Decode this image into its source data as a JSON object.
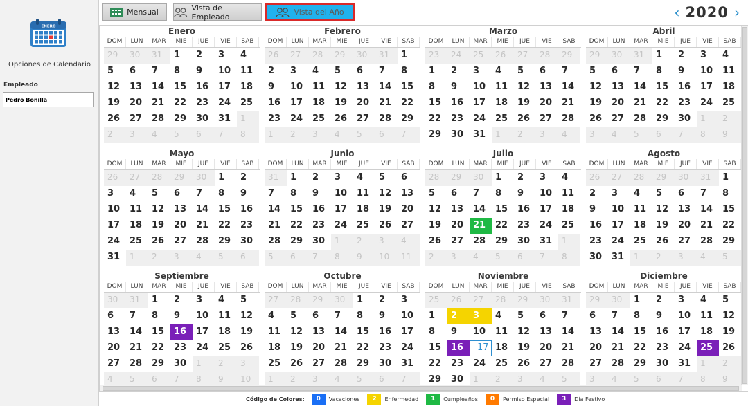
{
  "sidebar": {
    "logo_month": "ENERO",
    "title": "Opciones de Calendario",
    "employee_label": "Empleado",
    "employee_value": "Pedro Bonilla"
  },
  "toolbar": {
    "mensual_label": "Mensual",
    "empleado_label": "Vista de Empleado",
    "anio_label": "Vista del Año"
  },
  "year_nav": {
    "prev_icon": "‹",
    "next_icon": "›",
    "year": "2020"
  },
  "weekdays": [
    "DOM",
    "LUN",
    "MAR",
    "MIE",
    "JUE",
    "VIE",
    "SAB"
  ],
  "months": [
    {
      "name": "Enero",
      "lead": [
        29,
        30,
        31
      ],
      "days": 31,
      "trail": [
        1,
        2,
        3,
        4,
        5,
        6,
        7,
        8
      ]
    },
    {
      "name": "Febrero",
      "lead": [
        26,
        27,
        28,
        29,
        30,
        31
      ],
      "days": 29,
      "trail": [
        1,
        2,
        3,
        4,
        5,
        6,
        7
      ]
    },
    {
      "name": "Marzo",
      "lead": [
        23,
        24,
        25,
        26,
        27,
        28,
        29
      ],
      "days": 31,
      "trail": [
        1,
        2,
        3,
        4
      ]
    },
    {
      "name": "Abril",
      "lead": [
        29,
        30,
        31
      ],
      "days": 30,
      "trail": [
        1,
        2,
        3,
        4,
        5,
        6,
        7,
        8,
        9
      ]
    },
    {
      "name": "Mayo",
      "lead": [
        26,
        27,
        28,
        29,
        30
      ],
      "days": 31,
      "trail": [
        1,
        2,
        3,
        4,
        5,
        6
      ]
    },
    {
      "name": "Junio",
      "lead": [
        31
      ],
      "days": 30,
      "trail": [
        1,
        2,
        3,
        4,
        5,
        6,
        7,
        8,
        9,
        10,
        11
      ]
    },
    {
      "name": "Julio",
      "lead": [
        28,
        29,
        30
      ],
      "days": 31,
      "trail": [
        1,
        2,
        3,
        4,
        5,
        6,
        7,
        8
      ]
    },
    {
      "name": "Agosto",
      "lead": [
        26,
        27,
        28,
        29,
        30,
        31
      ],
      "days": 31,
      "trail": [
        1,
        2,
        3,
        4,
        5
      ]
    },
    {
      "name": "Septiembre",
      "lead": [
        30,
        31
      ],
      "days": 30,
      "trail": [
        1,
        2,
        3,
        4,
        5,
        6,
        7,
        8,
        9,
        10
      ]
    },
    {
      "name": "Octubre",
      "lead": [
        27,
        28,
        29,
        30
      ],
      "days": 31,
      "trail": [
        1,
        2,
        3,
        4,
        5,
        6,
        7
      ]
    },
    {
      "name": "Noviembre",
      "lead": [
        25,
        26,
        27,
        28,
        29,
        30,
        31
      ],
      "days": 30,
      "trail": [
        1,
        2,
        3,
        4,
        5
      ]
    },
    {
      "name": "Diciembre",
      "lead": [
        29,
        30
      ],
      "days": 31,
      "trail": [
        1,
        2,
        3,
        4,
        5,
        6,
        7,
        8,
        9
      ]
    }
  ],
  "highlights": [
    {
      "month": 6,
      "day": 21,
      "color": "green"
    },
    {
      "month": 8,
      "day": 16,
      "color": "purple"
    },
    {
      "month": 10,
      "day": 2,
      "color": "yellow"
    },
    {
      "month": 10,
      "day": 3,
      "color": "yellow"
    },
    {
      "month": 10,
      "day": 16,
      "color": "purple"
    },
    {
      "month": 11,
      "day": 25,
      "color": "purple"
    }
  ],
  "today": {
    "month": 10,
    "day": 17
  },
  "legend": {
    "title": "Código de Colores:",
    "items": [
      {
        "count": "0",
        "label": "Vacaciones",
        "color": "#1a6ff5"
      },
      {
        "count": "2",
        "label": "Enfermedad",
        "color": "#f5d400"
      },
      {
        "count": "1",
        "label": "Cumpleaños",
        "color": "#1fb944"
      },
      {
        "count": "0",
        "label": "Permiso Especial",
        "color": "#ff7a00"
      },
      {
        "count": "3",
        "label": "Día Festivo",
        "color": "#7a1fb8"
      }
    ]
  }
}
